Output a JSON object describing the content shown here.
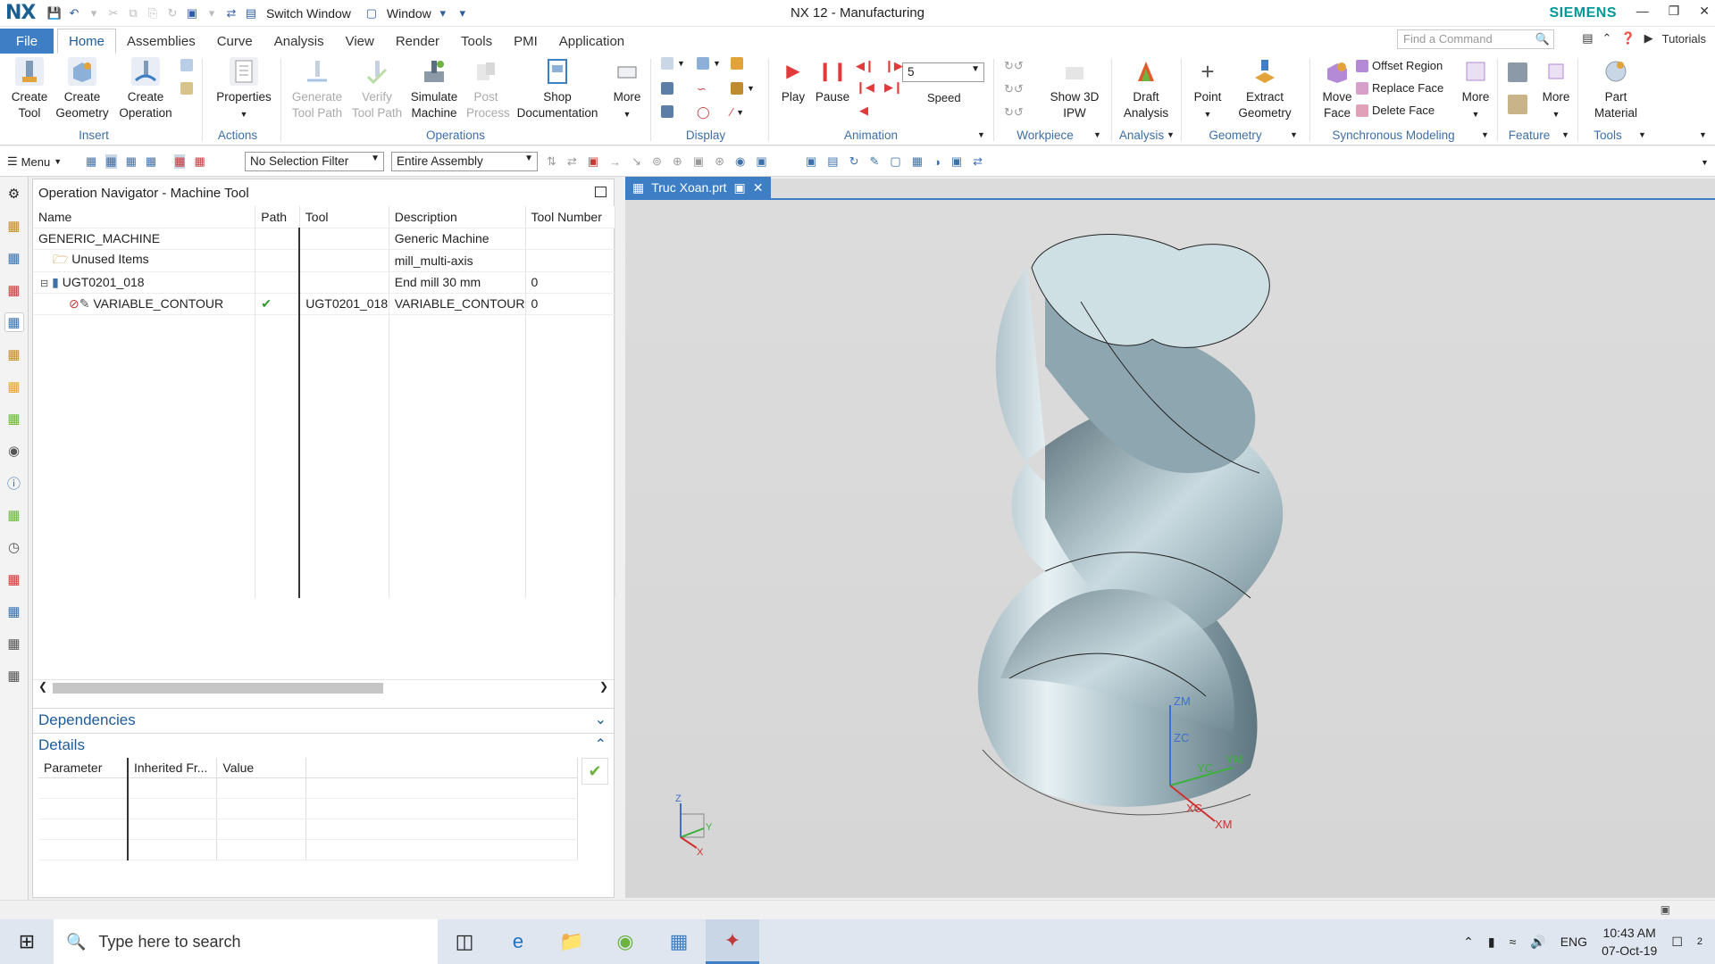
{
  "titlebar": {
    "title": "NX 12 - Manufacturing",
    "logo": "NX",
    "brand": "SIEMENS",
    "switch_window": "Switch Window",
    "window_menu": "Window"
  },
  "menubar": {
    "file": "File",
    "tabs": [
      "Home",
      "Assemblies",
      "Curve",
      "Analysis",
      "View",
      "Render",
      "Tools",
      "PMI",
      "Application"
    ],
    "find_placeholder": "Find a Command",
    "tutorials": "Tutorials"
  },
  "ribbon": {
    "create_tool": "Create\nTool",
    "create_geometry": "Create\nGeometry",
    "create_operation": "Create\nOperation",
    "properties": "Properties",
    "generate_tool_path": "Generate\nTool Path",
    "verify_tool_path": "Verify\nTool Path",
    "simulate_machine": "Simulate\nMachine",
    "post_process": "Post\nProcess",
    "shop_documentation": "Shop\nDocumentation",
    "more": "More",
    "play": "Play",
    "pause": "Pause",
    "speed_value": "5",
    "speed": "Speed",
    "show_3d_ipw": "Show 3D\nIPW",
    "draft_analysis": "Draft\nAnalysis",
    "point": "Point",
    "extract_geometry": "Extract\nGeometry",
    "move_face": "Move\nFace",
    "offset_region": "Offset Region",
    "replace_face": "Replace Face",
    "delete_face": "Delete Face",
    "more2": "More",
    "more3": "More",
    "part_material": "Part\nMaterial",
    "groups": {
      "insert": "Insert",
      "actions": "Actions",
      "operations": "Operations",
      "display": "Display",
      "animation": "Animation",
      "workpiece": "Workpiece",
      "analysis": "Analysis",
      "geometry": "Geometry",
      "synchronous": "Synchronous Modeling",
      "feature": "Feature",
      "tools": "Tools"
    }
  },
  "toolbar2": {
    "menu": "Menu",
    "selection_filter": "No Selection Filter",
    "scope": "Entire Assembly"
  },
  "navigator": {
    "title": "Operation Navigator - Machine Tool",
    "columns": [
      "Name",
      "Path",
      "Tool",
      "Description",
      "Tool Number"
    ],
    "rows": [
      {
        "name": "GENERIC_MACHINE",
        "path": "",
        "tool": "",
        "description": "Generic Machine",
        "number": ""
      },
      {
        "name": "Unused Items",
        "path": "",
        "tool": "",
        "description": "mill_multi-axis",
        "number": ""
      },
      {
        "name": "UGT0201_018",
        "path": "",
        "tool": "",
        "description": "End mill 30 mm",
        "number": "0"
      },
      {
        "name": "VARIABLE_CONTOUR",
        "path": "✔",
        "tool": "UGT0201_018",
        "description": "VARIABLE_CONTOUR",
        "number": "0"
      }
    ],
    "dependencies": "Dependencies",
    "details": "Details",
    "detail_columns": [
      "Parameter",
      "Inherited Fr...",
      "Value"
    ]
  },
  "viewport": {
    "tab": "Truc Xoan.prt",
    "axis": {
      "zm": "ZM",
      "zc": "ZC",
      "yc": "YC",
      "ym": "YM",
      "xc": "XC",
      "xm": "XM",
      "z": "Z",
      "y": "Y",
      "x": "X"
    }
  },
  "taskbar": {
    "search": "Type here to search",
    "lang": "ENG",
    "time": "10:43 AM",
    "date": "07-Oct-19",
    "notif": "2"
  },
  "colors": {
    "accent": "#3d7ec4",
    "brand": "#009999",
    "play": "#e03a3a"
  }
}
